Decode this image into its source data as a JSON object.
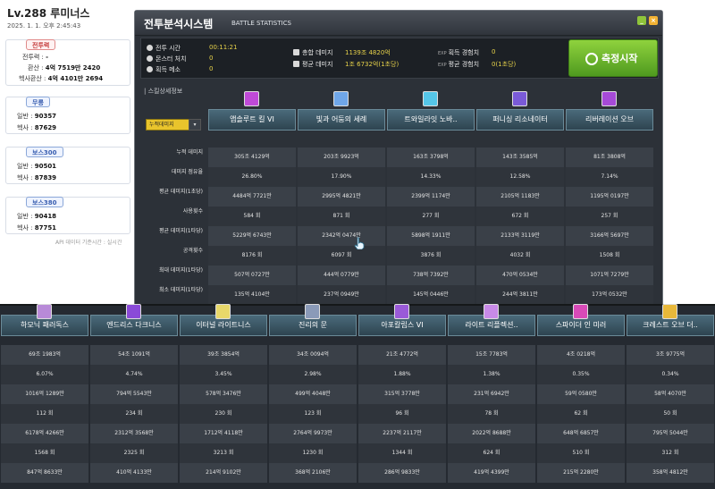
{
  "profile": {
    "title": "Lv.288 루미너스",
    "date": "2025. 1. 1. 오후 2:45:43",
    "power_badge": "전투력",
    "power_rows": [
      {
        "label": "전투력",
        "value": "-"
      },
      {
        "label": "환산",
        "value": "4억 7519만 2420"
      },
      {
        "label": "헥사환산",
        "value": "4억 4101만 2694"
      }
    ],
    "cards": [
      {
        "badge": "무릉",
        "rows": [
          {
            "label": "일반",
            "value": "90357"
          },
          {
            "label": "헥사",
            "value": "87629"
          }
        ]
      },
      {
        "badge": "보스300",
        "rows": [
          {
            "label": "일반",
            "value": "90501"
          },
          {
            "label": "헥사",
            "value": "87839"
          }
        ]
      },
      {
        "badge": "보스380",
        "rows": [
          {
            "label": "일반",
            "value": "90418"
          },
          {
            "label": "헥사",
            "value": "87751"
          }
        ]
      }
    ],
    "api_note": "API 데이터 기준시간 : 실시간"
  },
  "window": {
    "title_ko": "전투분석시스템",
    "title_en": "BATTLE STATISTICS",
    "btn_min": "_",
    "btn_close": "×"
  },
  "summary": {
    "combat_time_label": "전투 시간",
    "combat_time": "00:11:21",
    "monsters_label": "몬스터 처치",
    "monsters": "0",
    "meso_label": "획득 메소",
    "meso": "0",
    "total_damage_label": "총합 데미지",
    "total_damage": "1139조 4820억",
    "avg_damage_label": "평균 데미지",
    "avg_damage": "1조 6732억(1초당)",
    "exp_label": "획득 경험치",
    "exp": "0",
    "avg_exp_label": "평균 경험치",
    "avg_exp": "0(1초당)",
    "exp_tag": "EXP"
  },
  "measure_button": "측정시작",
  "section_label": "| 스킬상세정보",
  "filter_label": "누적데미지",
  "filter_arrow": "▾",
  "row_labels": [
    "누적 데미지",
    "데미지 점유율",
    "평균 데미지(1초당)",
    "사용횟수",
    "평균 데미지(1타당)",
    "공격횟수",
    "최대 데미지(1타당)",
    "최소 데미지(1타당)"
  ],
  "skills": [
    {
      "name": "앱솔루트 킬 VI",
      "icon_color": "#c04ad8",
      "values": [
        "305조 4129억",
        "26.80%",
        "4484억 7721만",
        "584 회",
        "5229억 6743만",
        "8176 회",
        "507억 0727만",
        "135억 4104만"
      ]
    },
    {
      "name": "빛과 어둠의 세례",
      "icon_color": "#6fa6e8",
      "values": [
        "203조 9923억",
        "17.90%",
        "2995억 4821만",
        "871 회",
        "2342억 0474만",
        "6097 회",
        "444억 0779만",
        "237억 0949만"
      ]
    },
    {
      "name": "트와일라잇 노바..",
      "icon_color": "#55c6e8",
      "values": [
        "163조 3798억",
        "14.33%",
        "2399억 1174만",
        "277 회",
        "5898억 1911만",
        "3876 회",
        "738억 7392만",
        "145억 0446만"
      ]
    },
    {
      "name": "퍼니싱 리소네이터",
      "icon_color": "#7a5ad8",
      "values": [
        "143조 3585억",
        "12.58%",
        "2105억 1183만",
        "672 회",
        "2133억 3119만",
        "4032 회",
        "470억 0534만",
        "244억 3811만"
      ]
    },
    {
      "name": "리버레이션 오브",
      "icon_color": "#a64ad8",
      "values": [
        "81조 3808억",
        "7.14%",
        "1195억 0197만",
        "257 회",
        "3166억 5697만",
        "1508 회",
        "1071억 7279만",
        "173억 0532만"
      ]
    }
  ],
  "bottom_skills": [
    {
      "name": "하모닉 패러독스",
      "icon_color": "#b88ad8",
      "values": [
        "69조 1983억",
        "6.07%",
        "1016억 1289만",
        "112 회",
        "6178억 4266만",
        "1568 회",
        "847억 8633만"
      ]
    },
    {
      "name": "엔드리스 다크니스",
      "icon_color": "#8a4ad8",
      "values": [
        "54조 1091억",
        "4.74%",
        "794억 5543만",
        "234 회",
        "2312억 3568만",
        "2325 회",
        "410억 4133만"
      ]
    },
    {
      "name": "이터널 라이트니스",
      "icon_color": "#e8d86a",
      "values": [
        "39조 3854억",
        "3.45%",
        "578억 3476만",
        "230 회",
        "1712억 4118만",
        "3213 회",
        "214억 9102만"
      ]
    },
    {
      "name": "진리의 문",
      "icon_color": "#8a9ab8",
      "values": [
        "34조 0094억",
        "2.98%",
        "499억 4048만",
        "123 회",
        "2764억 9973만",
        "1230 회",
        "368억 2106만"
      ]
    },
    {
      "name": "아포칼립스 VI",
      "icon_color": "#9a5ad8",
      "values": [
        "21조 4772억",
        "1.88%",
        "315억 3778만",
        "96 회",
        "2237억 2117만",
        "1344 회",
        "286억 9833만"
      ]
    },
    {
      "name": "라이트 리플렉션..",
      "icon_color": "#c88ae8",
      "values": [
        "15조 7783억",
        "1.38%",
        "231억 6942만",
        "78 회",
        "2022억 8688만",
        "624 회",
        "419억 4399만"
      ]
    },
    {
      "name": "스파이더 인 미러",
      "icon_color": "#d84ab8",
      "values": [
        "4조 0218억",
        "0.35%",
        "59억 0580만",
        "62 회",
        "648억 6857만",
        "510 회",
        "215억 2280만"
      ]
    },
    {
      "name": "크레스트 오브 더..",
      "icon_color": "#e8b83a",
      "values": [
        "3조 9775억",
        "0.34%",
        "58억 4070만",
        "50 회",
        "795억 5044만",
        "312 회",
        "358억 4812만"
      ]
    }
  ]
}
